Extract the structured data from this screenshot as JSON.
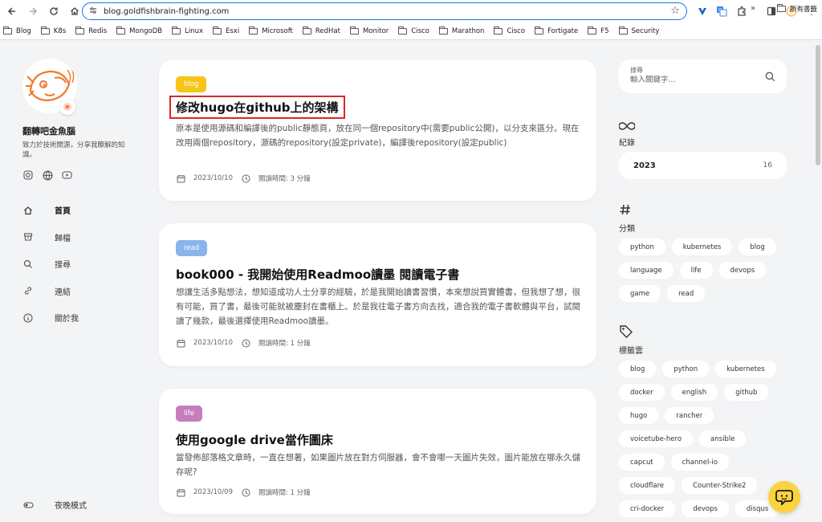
{
  "browser": {
    "url": "blog.goldfishbrain-fighting.com",
    "bookmarks": [
      "Blog",
      "K8s",
      "Redis",
      "MongoDB",
      "Linux",
      "Esxi",
      "Microsoft",
      "RedHat",
      "Monitor",
      "Cisco",
      "Marathon",
      "Cisco",
      "Fortigate",
      "F5",
      "Security"
    ],
    "more": "»",
    "all_bookmarks": "所有書籤"
  },
  "sidebar": {
    "site_title": "翻轉吧金魚腦",
    "site_desc": "致力於技術開源，分享我瞭解的知識。",
    "menu": [
      {
        "label": "首頁",
        "icon": "home-icon"
      },
      {
        "label": "歸檔",
        "icon": "archive-icon"
      },
      {
        "label": "搜尋",
        "icon": "search-icon"
      },
      {
        "label": "連結",
        "icon": "link-icon"
      },
      {
        "label": "關於我",
        "icon": "info-icon"
      }
    ],
    "dark_mode": "夜晚模式"
  },
  "posts": [
    {
      "tag": "blog",
      "tag_color": "#f5c518",
      "title": "修改hugo在github上的架構",
      "summary": "原本是使用源碼和編譯後的public靜態頁，放在同一個repository中(需要public公開)，以分支來區分。現在改用兩個repository，源碼的repository(設定private)，編譯後repository(設定public)",
      "date": "2023/10/10",
      "reading": "閱讀時間: 3 分鐘"
    },
    {
      "tag": "read",
      "tag_color": "#8cb4ec",
      "title": "book000 - 我開始使用Readmoo讀墨 閱讀電子書",
      "summary": "想讓生活多點想法，想知道成功人士分享的經驗，於是我開始讀書習慣，本來想說買實體書，但我想了想，很有可能，買了書，最後可能就被塵封在書櫃上。於是我往電子書方向去找，適合我的電子書軟體與平台，試閱讀了幾款，最後選擇使用Readmoo讀墨。",
      "date": "2023/10/10",
      "reading": "閱讀時間: 1 分鐘"
    },
    {
      "tag": "life",
      "tag_color": "#c77dbb",
      "title": "使用google drive當作圖床",
      "summary": "當發佈部落格文章時，一直在想著，如果圖片放在對方伺服器，會不會哪一天圖片失效，圖片能放在哪永久儲存呢?",
      "date": "2023/10/09",
      "reading": "閱讀時間: 1 分鐘"
    }
  ],
  "search": {
    "label": "搜尋",
    "placeholder": "輸入關鍵字..."
  },
  "archives": {
    "title": "紀錄",
    "year": "2023",
    "count": "16"
  },
  "categories": {
    "title": "分類",
    "items": [
      "python",
      "kubernetes",
      "blog",
      "language",
      "life",
      "devops",
      "game",
      "read"
    ]
  },
  "tags": {
    "title": "標籤雲",
    "items": [
      "blog",
      "python",
      "kubernetes",
      "docker",
      "english",
      "github",
      "hugo",
      "rancher",
      "voicetube-hero",
      "ansible",
      "capcut",
      "channel-io",
      "cloudflare",
      "Counter-Strike2",
      "cri-docker",
      "devops",
      "disqus"
    ]
  }
}
